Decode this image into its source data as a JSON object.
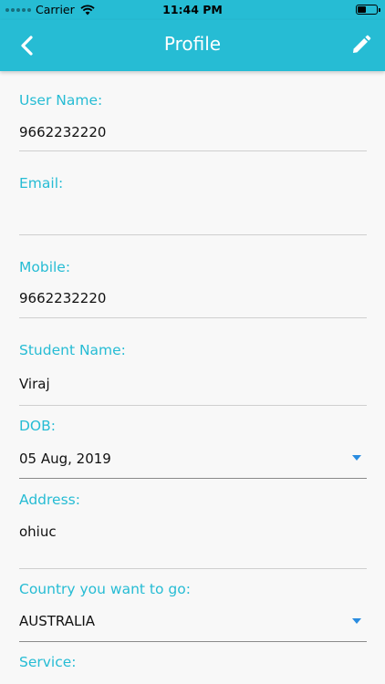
{
  "status_bar": {
    "carrier": "Carrier",
    "time": "11:44 PM",
    "battery_level": 0.45
  },
  "nav": {
    "title": "Profile",
    "back_icon": "chevron-left-icon",
    "edit_icon": "pencil-icon"
  },
  "colors": {
    "accent": "#26bcd4",
    "dropdown_caret": "#2a8ce0",
    "background": "#f8f8f8"
  },
  "fields": {
    "user_name": {
      "label": "User Name:",
      "value": "9662232220"
    },
    "email": {
      "label": "Email:",
      "value": ""
    },
    "mobile": {
      "label": "Mobile:",
      "value": "9662232220"
    },
    "student_name": {
      "label": "Student Name:",
      "value": "Viraj"
    },
    "dob": {
      "label": "DOB:",
      "value": "05 Aug, 2019"
    },
    "address": {
      "label": "Address:",
      "value": "ohiuc"
    },
    "country": {
      "label": "Country you want to go:",
      "value": "AUSTRALIA"
    },
    "service": {
      "label": "Service:"
    }
  }
}
